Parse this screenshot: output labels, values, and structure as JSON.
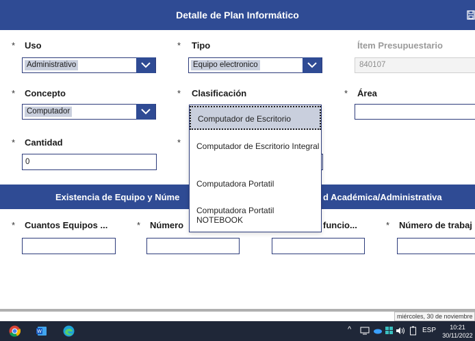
{
  "header": {
    "title": "Detalle de Plan Informático"
  },
  "fields": {
    "uso": {
      "label": "Uso",
      "value": "Administrativo"
    },
    "tipo": {
      "label": "Tipo",
      "value": "Equipo electronico"
    },
    "item": {
      "label": "Ítem Presupuestario",
      "value": "840107"
    },
    "concepto": {
      "label": "Concepto",
      "value": "Computador"
    },
    "clasificacion": {
      "label": "Clasificación"
    },
    "area": {
      "label": "Área"
    },
    "cantidad": {
      "label": "Cantidad",
      "value": "0"
    }
  },
  "asterisk": "*",
  "dropdown_options": [
    "Computador de Escritorio",
    "Computador de Escritorio Integral",
    "Computadora Portatil",
    "Computadora Portatil NOTEBOOK"
  ],
  "section": {
    "left": "Existencia de Equipo y Núme",
    "right": "d Académica/Administrativa"
  },
  "columns": {
    "c1": "Cuantos Equipos ...",
    "c2": "Número",
    "c3": "funcio...",
    "c4": "Número de trabaj"
  },
  "tooltip": "miércoles, 30 de noviembre",
  "taskbar": {
    "lang": "ESP",
    "time": "10:21",
    "date": "30/11/2022",
    "tray_up": "^"
  },
  "colors": {
    "primary": "#2f4b94",
    "selected": "#c9cfdd",
    "taskbar": "#1f2738"
  }
}
